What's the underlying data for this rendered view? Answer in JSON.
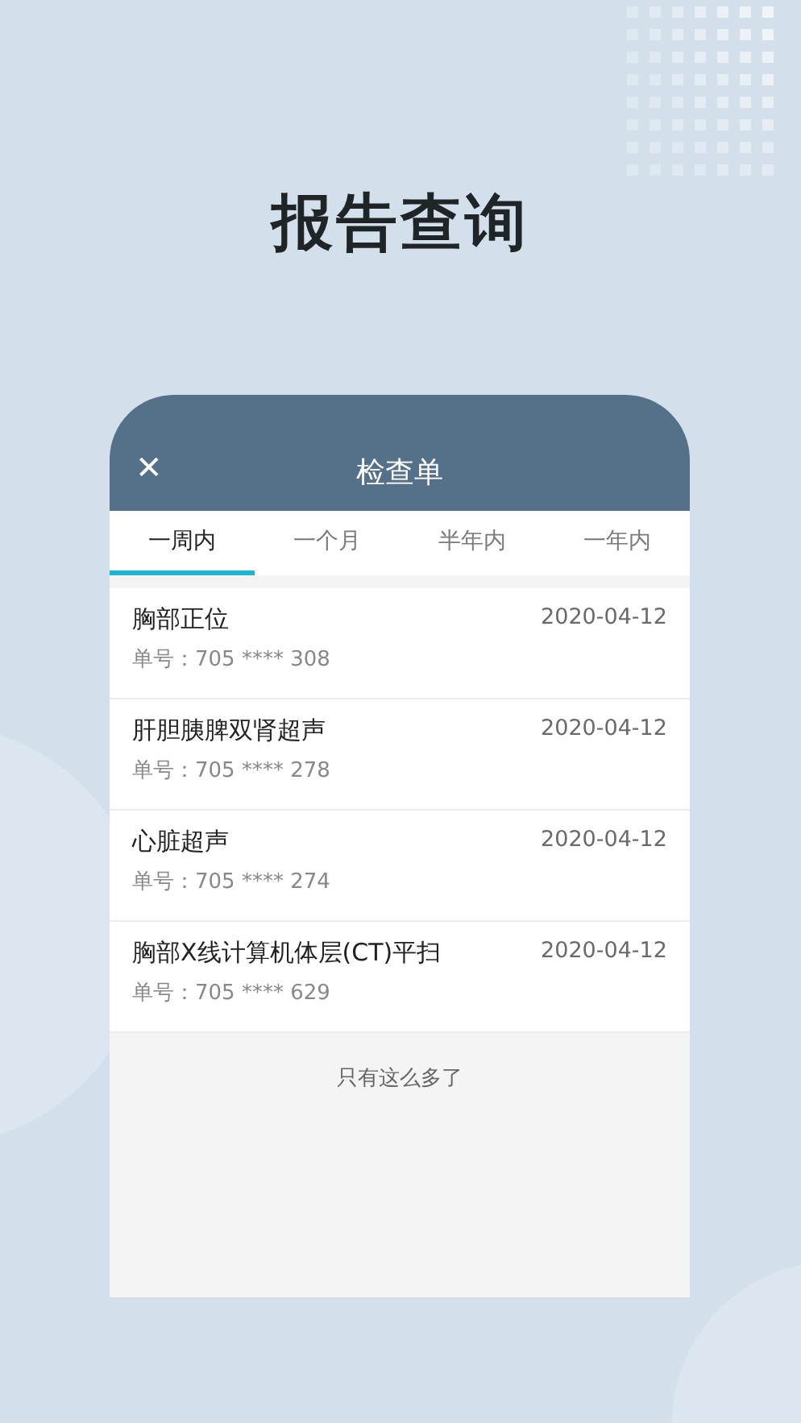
{
  "headline": "报告查询",
  "dialog": {
    "close_icon": "✕",
    "title": "检查单"
  },
  "tabs": [
    {
      "label": "一周内",
      "selected": true
    },
    {
      "label": "一个月",
      "selected": false
    },
    {
      "label": "半年内",
      "selected": false
    },
    {
      "label": "一年内",
      "selected": false
    }
  ],
  "reports": [
    {
      "name": "胸部正位",
      "date": "2020-04-12",
      "number": "单号：705 **** 308"
    },
    {
      "name": "肝胆胰脾双肾超声",
      "date": "2020-04-12",
      "number": "单号：705 **** 278"
    },
    {
      "name": "心脏超声",
      "date": "2020-04-12",
      "number": "单号：705 **** 274"
    },
    {
      "name": "胸部X线计算机体层(CT)平扫",
      "date": "2020-04-12",
      "number": "单号：705 **** 629"
    }
  ],
  "end_note": "只有这么多了"
}
